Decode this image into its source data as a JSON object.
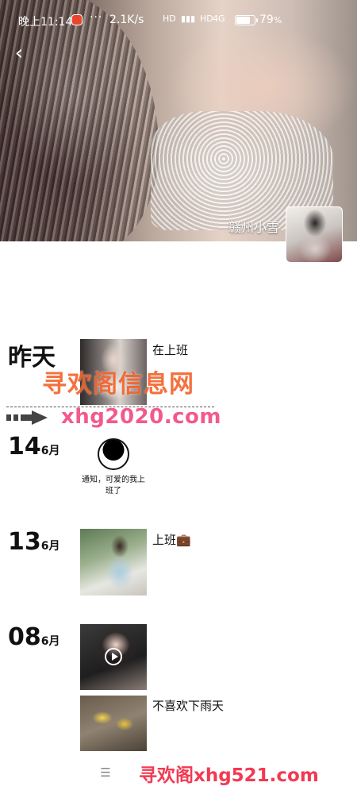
{
  "status_bar": {
    "time": "晚上11:14",
    "dots": "···",
    "net_speed": "2.1K/s",
    "sig1": "HD",
    "sig2": "HD",
    "sig3": "4G",
    "battery_text": "79",
    "battery_unit": "%",
    "battery_level": 0.79
  },
  "profile": {
    "nickname": "赣州小雪"
  },
  "feed": [
    {
      "day": "昨天",
      "posts": [
        {
          "text": "在上班",
          "type": "image"
        }
      ]
    },
    {
      "day": "14",
      "month": "6月",
      "posts": [
        {
          "text": "",
          "type": "meme",
          "meme_caption": "通知，可爱的我上班了"
        }
      ]
    },
    {
      "day": "13",
      "month": "6月",
      "posts": [
        {
          "text": "上班💼",
          "type": "image"
        }
      ]
    },
    {
      "day": "08",
      "month": "6月",
      "posts": [
        {
          "text": "",
          "type": "video"
        },
        {
          "text": "不喜欢下雨天",
          "type": "image"
        }
      ]
    }
  ],
  "watermarks": {
    "wm1": "寻欢阁信息网",
    "wm2": "xhg2020.com",
    "wm3": "寻欢阁xhg521.com"
  },
  "bottom_nav": {
    "menu_glyph": "☰"
  }
}
